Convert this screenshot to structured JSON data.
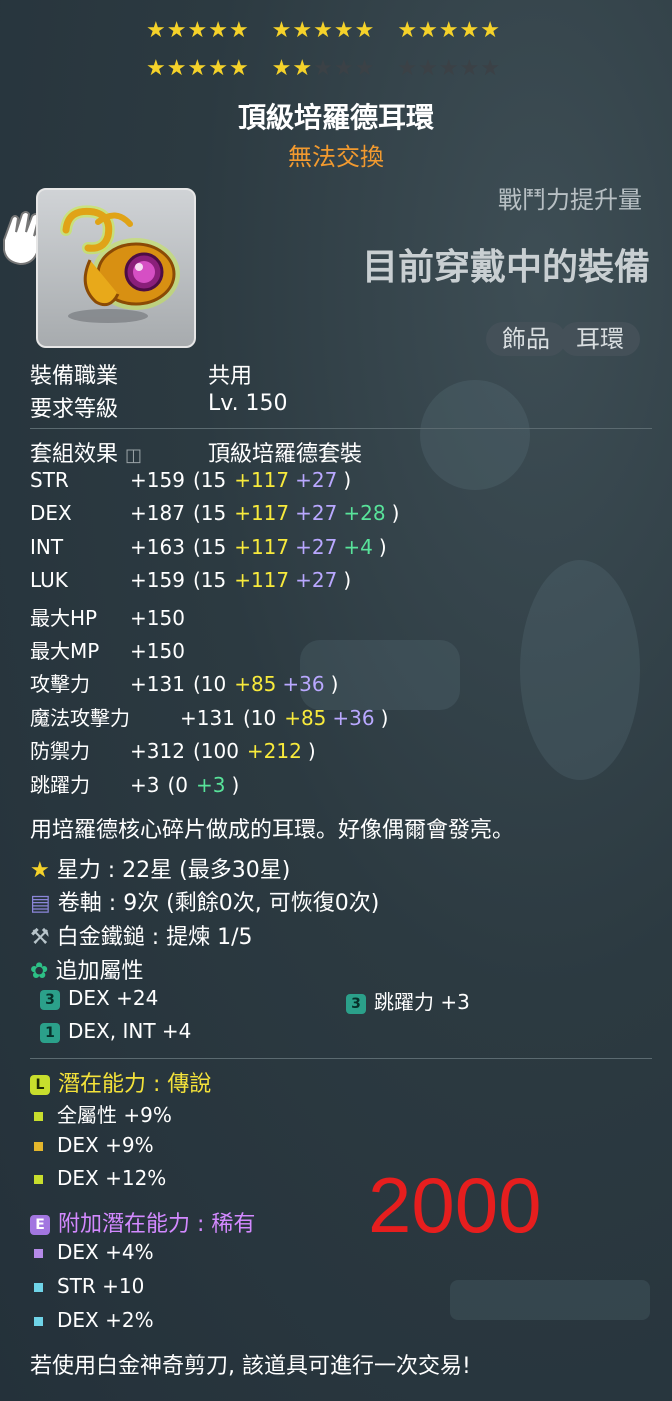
{
  "item": {
    "title": "頂級培羅德耳環",
    "trade_status": "無法交換",
    "cp_label": "戰鬥力提升量",
    "equipped_label": "目前穿戴中的裝備",
    "tags": [
      "飾品",
      "耳環"
    ],
    "star_force": {
      "current": 22,
      "max": 30
    }
  },
  "requirements": [
    {
      "label": "裝備職業",
      "value": "共用"
    },
    {
      "label": "要求等級",
      "value": "Lv. 150"
    }
  ],
  "set_effect": {
    "label": "套組效果",
    "value": "頂級培羅德套裝"
  },
  "stats": [
    {
      "name": "STR",
      "total": "+159",
      "base": "(15",
      "bonus": "+117",
      "scroll": "+27",
      "extra": "",
      "close": ")"
    },
    {
      "name": "DEX",
      "total": "+187",
      "base": "(15",
      "bonus": "+117",
      "scroll": "+27",
      "extra": "+28",
      "close": ")"
    },
    {
      "name": "INT",
      "total": "+163",
      "base": "(15",
      "bonus": "+117",
      "scroll": "+27",
      "extra": "+4",
      "close": ")"
    },
    {
      "name": "LUK",
      "total": "+159",
      "base": "(15",
      "bonus": "+117",
      "scroll": "+27",
      "extra": "",
      "close": ")"
    },
    {
      "name": "最大HP",
      "total": "+150",
      "base": "",
      "bonus": "",
      "scroll": "",
      "extra": "",
      "close": ""
    },
    {
      "name": "最大MP",
      "total": "+150",
      "base": "",
      "bonus": "",
      "scroll": "",
      "extra": "",
      "close": ""
    },
    {
      "name": "攻擊力",
      "total": "+131",
      "base": "(10",
      "bonus": "+85",
      "scroll": "+36",
      "extra": "",
      "close": ")"
    },
    {
      "name": "魔法攻擊力",
      "total": "+131",
      "base": "(10",
      "bonus": "+85",
      "scroll": "+36",
      "extra": "",
      "close": ")"
    },
    {
      "name": "防禦力",
      "total": "+312",
      "base": "(100",
      "bonus": "+212",
      "scroll": "",
      "extra": "",
      "close": ")"
    },
    {
      "name": "跳躍力",
      "total": "+3",
      "base": "(0",
      "bonus": "",
      "scroll": "",
      "extra": "+3",
      "close": ")"
    }
  ],
  "description": "用培羅德核心碎片做成的耳環。好像偶爾會發亮。",
  "enhancements": {
    "star_line": "星力 : 22星 (最多30星)",
    "scroll_line": "卷軸 : 9次 (剩餘0次, 可恢復0次)",
    "hammer_line": "白金鐵鎚 : 提煉 1/5",
    "flame_label": "追加屬性",
    "flames": [
      {
        "badge": "3",
        "text": "DEX  +24"
      },
      {
        "badge": "3",
        "text": "跳躍力 +3"
      },
      {
        "badge": "1",
        "text": "DEX, INT  +4"
      }
    ]
  },
  "potential": {
    "badge": "L",
    "title": "潛在能力 : 傳說",
    "lines": [
      "全屬性 +9%",
      "DEX +9%",
      "DEX +12%"
    ]
  },
  "bonus_potential": {
    "badge": "E",
    "title": "附加潛在能力 : 稀有",
    "lines": [
      "DEX +4%",
      "STR +10",
      "DEX +2%"
    ]
  },
  "footer": "若使用白金神奇剪刀, 該道具可進行一次交易!",
  "price": "2000",
  "colors": {
    "star_on": "#f5d22a",
    "star_off": "#3b4146",
    "untradable": "#f29a2f",
    "bonus_yellow": "#f8ea3c",
    "scroll_purple": "#b9a8ff",
    "extra_green": "#58e39a",
    "potential_legend": "#c8de2d",
    "potential_epic": "#a276e0",
    "price_red": "#e61e1e"
  }
}
